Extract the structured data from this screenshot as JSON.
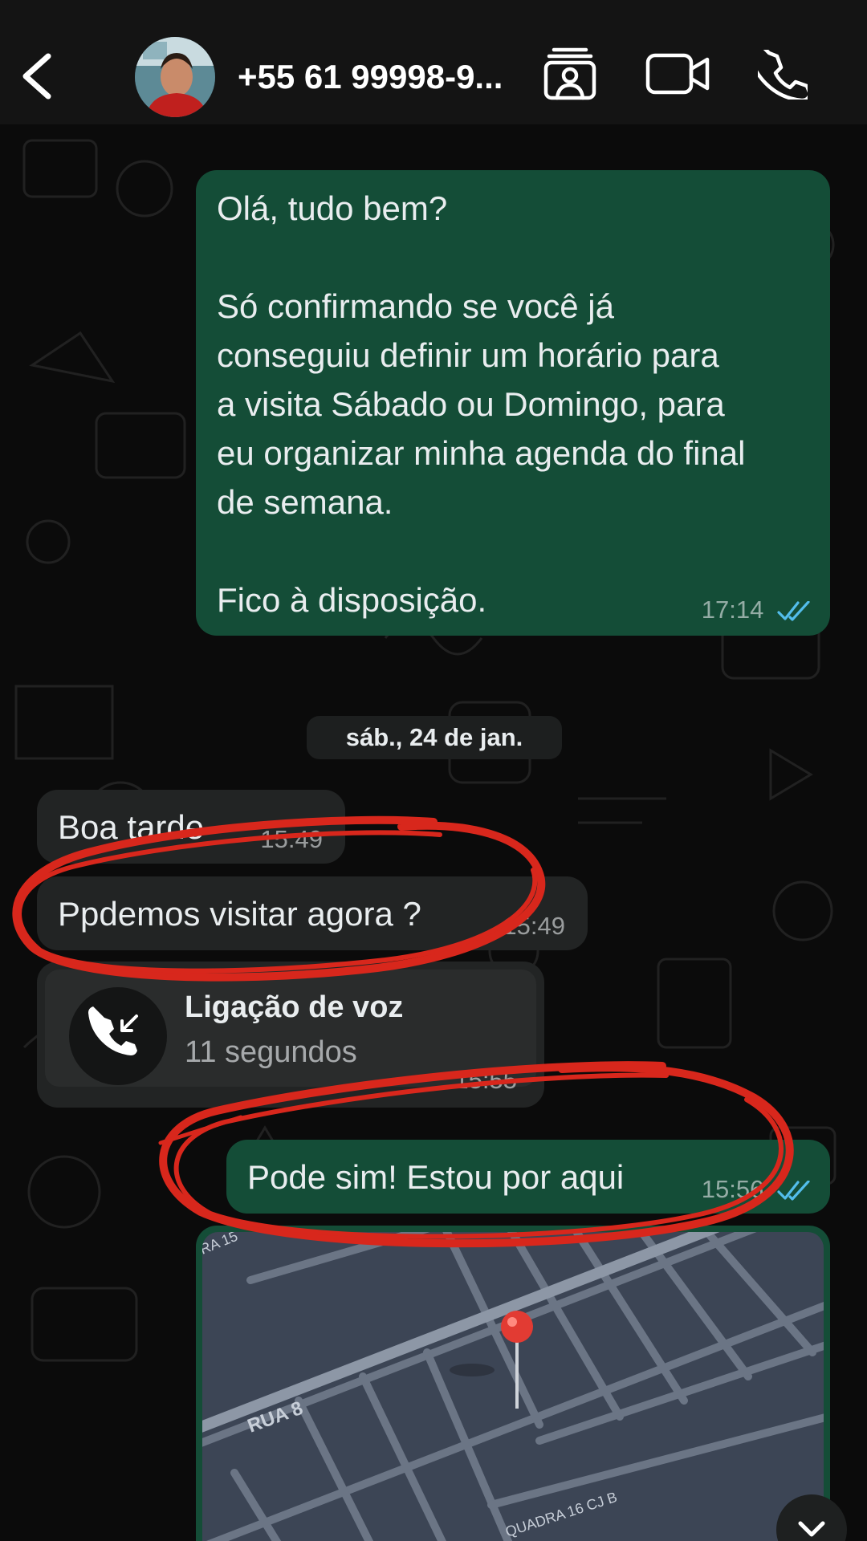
{
  "header": {
    "contact_name": "+55 61 99998-9...",
    "icons": [
      "back-icon",
      "avatar",
      "contact-card-icon",
      "video-call-icon",
      "voice-call-icon"
    ]
  },
  "messages": [
    {
      "direction": "outgoing",
      "text": "Olá, tudo bem?\n\nSó confirmando se você já\nconseguiu definir um horário para\na visita Sábado ou Domingo, para\neu organizar minha agenda do final\nde semana.\n\nFico à disposição.",
      "time": "17:14",
      "status": "read"
    },
    {
      "direction": "incoming",
      "text": "Boa tarde",
      "time": "15:49"
    },
    {
      "direction": "incoming",
      "text": "Ppdemos visitar agora ?",
      "time": "15:49"
    },
    {
      "direction": "incoming",
      "type": "call",
      "title": "Ligação de voz",
      "duration": "11 segundos",
      "time": "15:55"
    },
    {
      "direction": "outgoing",
      "text": "Pode sim! Estou por aqui",
      "time": "15:56",
      "status": "read"
    },
    {
      "direction": "outgoing",
      "type": "location",
      "map_labels": [
        "RA 15",
        "RUA 8",
        "QUADRA 16 CJ B"
      ]
    }
  ],
  "date_separator": "sáb., 24 de jan.",
  "colors": {
    "outgoing_bubble": "#144d37",
    "incoming_bubble": "#222424",
    "read_ticks": "#53bdeb",
    "annotation": "#d8271c"
  }
}
